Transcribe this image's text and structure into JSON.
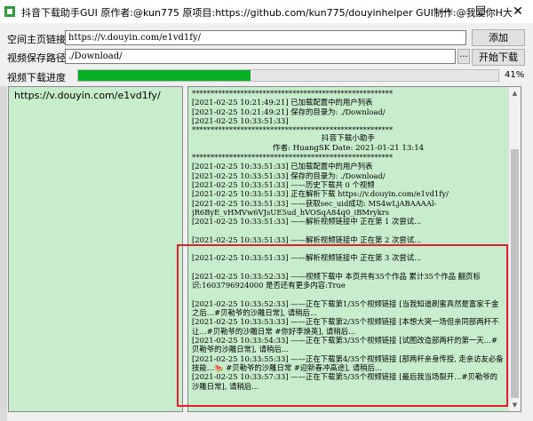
{
  "window": {
    "title": "抖音下载助手GUI 原作者:@kun775 原项目:https://github.com/kun775/douyinhelper GUI制作:@我爱你H大",
    "minimize": "—",
    "maximize": "☐",
    "close": "✕"
  },
  "form": {
    "url_label": "空间主页链接",
    "url_value": "https://v.douyin.com/e1vd1fy/",
    "add_button": "添加",
    "path_label": "视频保存路径",
    "path_value": "./Download/",
    "path_browse": "...",
    "start_button": "开始下载",
    "progress_label": "视频下载进度",
    "progress_text": "41%",
    "progress_fraction": 0.41
  },
  "url_list": [
    "https://v.douyin.com/e1vd1fy/"
  ],
  "log": [
    {
      "text": "******************************************************",
      "style": "line"
    },
    {
      "text": "[2021-02-25 10:21:49:21] 已加载配置中的用户列表",
      "style": "line"
    },
    {
      "text": "[2021-02-25 10:21:49:21] 保存的目录为: ./Download/",
      "style": "line"
    },
    {
      "text": "[2021-02-25 10:33:51:33]",
      "style": "line"
    },
    {
      "text": "******************************************************",
      "style": "line"
    },
    {
      "text": "抖音下载小助手",
      "style": "center"
    },
    {
      "text": "作者: HuangSK  Date: 2021-01-21 13:14",
      "style": "center"
    },
    {
      "text": "******************************************************",
      "style": "line"
    },
    {
      "text": "[2021-02-25 10:33:51:33] 已加载配置中的用户列表",
      "style": "line"
    },
    {
      "text": "[2021-02-25 10:33:51:33] 保存的目录为: ./Download/",
      "style": "line"
    },
    {
      "text": "[2021-02-25 10:33:51:33] ——历史下载共 0 个视频",
      "style": "line"
    },
    {
      "text": "[2021-02-25 10:33:51:33] 正在解析下载 https://v.douyin.com/e1vd1fy/",
      "style": "line"
    },
    {
      "text": "[2021-02-25 10:33:51:33] ——获取sec_uid成功: MS4wLjABAAAAl-",
      "style": "line"
    },
    {
      "text": "jR6ByE_vHMVw6VJsUE5ud_hVOSqA84q0_iBMrykrs",
      "style": "line"
    },
    {
      "text": "[2021-02-25 10:33:51:33] ——解析视频链接中 正在第 1 次尝试...",
      "style": "line"
    },
    {
      "text": "",
      "style": "line"
    },
    {
      "text": "[2021-02-25 10:33:51:33] ——解析视频链接中 正在第 2 次尝试...",
      "style": "line"
    },
    {
      "text": "",
      "style": "line"
    },
    {
      "text": "[2021-02-25 10:33:51:33] ——解析视频链接中 正在第 3 次尝试...",
      "style": "line"
    },
    {
      "text": "",
      "style": "line"
    },
    {
      "text": "[2021-02-25 10:33:52:33] ——视频下载中 本页共有35个作品 累计35个作品 翻页标识:1603796924000 是否还有更多内容:True",
      "style": "wrap"
    },
    {
      "text": "",
      "style": "line"
    },
    {
      "text": "[2021-02-25 10:33:52:33] ——正在下载第1/35个视频链接 [当我知道刷蜜真然是富家千金之后…#贝勒爷的沙雕日常], 请稍后...",
      "style": "wrap"
    },
    {
      "text": "[2021-02-25 10:33:53:33] ——正在下载第2/35个视频链接 [本想大哭一场但亲同部两杆不让…#贝勒爷的沙雕日常 #你好李焕英], 请稍后...",
      "style": "wrap"
    },
    {
      "text": "[2021-02-25 10:33:54:33] ——正在下载第3/35个视频链接 [试图改造部两杆的第一天…#贝勒爷的沙雕日常], 请稍后...",
      "style": "wrap"
    },
    {
      "text": "[2021-02-25 10:33:55:33] ——正在下载第4/35个视频链接 [部两杆亲身传授, 走亲访友必备技能…🍉 #贝勒爷的沙雕日常 #迎新春冲高途], 请稍后...",
      "style": "wrap"
    },
    {
      "text": "[2021-02-25 10:33:57:33] ——正在下载第5/35个视频链接 [最后我当场裂开…#贝勒爷的沙雕日常], 请稍后...",
      "style": "wrap"
    }
  ]
}
